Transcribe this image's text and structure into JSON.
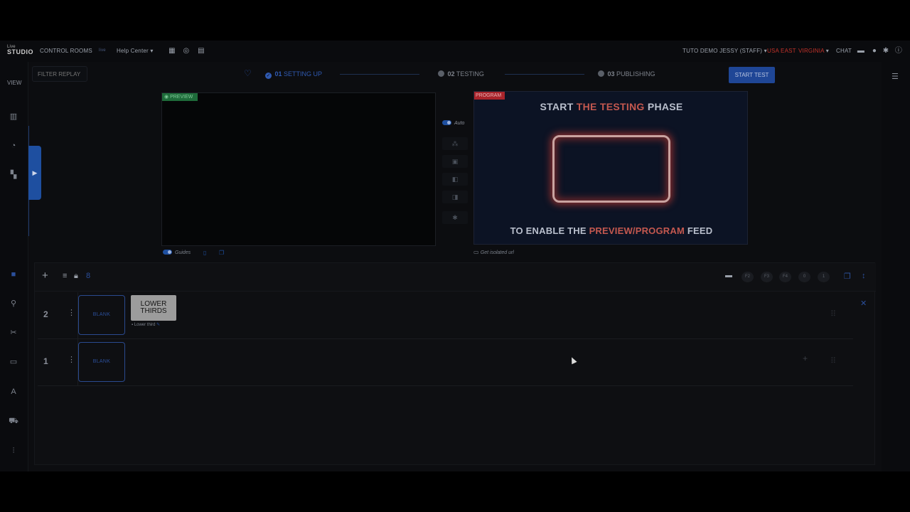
{
  "topbar": {
    "logo_line1": "Live",
    "logo_line2": "STUDIO",
    "control_rooms": "CONTROL ROOMS",
    "control_badge": "live",
    "help_center": "Help Center",
    "account": "TUTO DEMO JESSY (STAFF)",
    "region": "USA EAST",
    "region_sub": "VIRGINIA",
    "chat": "CHAT",
    "icons": [
      "calendar-icon",
      "lifebuoy-icon",
      "grid-icon",
      "chat-bubble-icon",
      "user-icon",
      "gear-icon",
      "info-icon"
    ]
  },
  "sidebar": {
    "view_label": "VIEW",
    "icons": [
      "chart-icon",
      "speedometer-icon",
      "layout-icon",
      "camera-icon",
      "antenna-icon",
      "tools-icon",
      "presentation-icon",
      "text-icon",
      "truck-icon",
      "sliders-icon"
    ]
  },
  "filter_replay": {
    "placeholder": "FILTER REPLAY"
  },
  "steps": [
    {
      "number": "01",
      "label": "SETTING UP",
      "state": "done"
    },
    {
      "number": "02",
      "label": "TESTING",
      "state": "pending"
    },
    {
      "number": "03",
      "label": "PUBLISHING",
      "state": "pending"
    }
  ],
  "start_test_label": "START TEST",
  "preview": {
    "badge": "PREVIEW",
    "guides_label": "Guides"
  },
  "controls": {
    "auto_label": "Auto"
  },
  "program": {
    "badge": "PROGRAM",
    "title_pre": "START ",
    "title_hl": "THE TESTING",
    "title_post": " PHASE",
    "sub_pre": "TO ENABLE THE ",
    "sub_hl": "PREVIEW/PROGRAM",
    "sub_post": " FEED",
    "isolated_label": "Get isolated url",
    "neon_color": "#c83c32"
  },
  "scene_panel": {
    "count_badge": "8",
    "fkeys": [
      "F2",
      "F3",
      "F4",
      "0",
      "1"
    ],
    "rows": [
      {
        "number": "2",
        "blank_label": "BLANK",
        "lower_third": "LOWER THIRDS",
        "lower_third_label": "Lower third"
      },
      {
        "number": "1",
        "blank_label": "BLANK"
      }
    ]
  },
  "colors": {
    "accent": "#1f4696",
    "preview_green": "#1e6b3a",
    "program_red": "#a8242b",
    "region_red": "#c3322a"
  }
}
